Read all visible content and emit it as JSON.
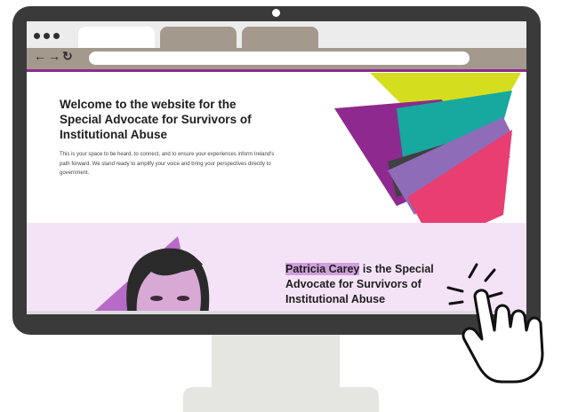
{
  "colors": {
    "bezel": "#3a3a3a",
    "accent_purple": "#8e2a8f",
    "tab_brown": "#a4998d",
    "section_pink": "#f4e3f6",
    "highlight": "#cfa0dc"
  },
  "browser": {
    "nav_icons": "← → ↻",
    "url": ""
  },
  "hero": {
    "title": "Welcome to the website for the Special Advocate for Survivors of Institutional Abuse",
    "text": "This is your space to be heard, to connect, and to ensure your experiences inform Ireland's path forward. We stand ready to amplify your voice and bring your perspectives directly to government."
  },
  "profile": {
    "name": "Patricia Carey",
    "rest": " is the Special Advocate for Survivors of Institutional Abuse"
  },
  "icons": [
    "camera-icon",
    "back-arrow-icon",
    "forward-arrow-icon",
    "reload-icon",
    "pointing-hand-icon"
  ]
}
